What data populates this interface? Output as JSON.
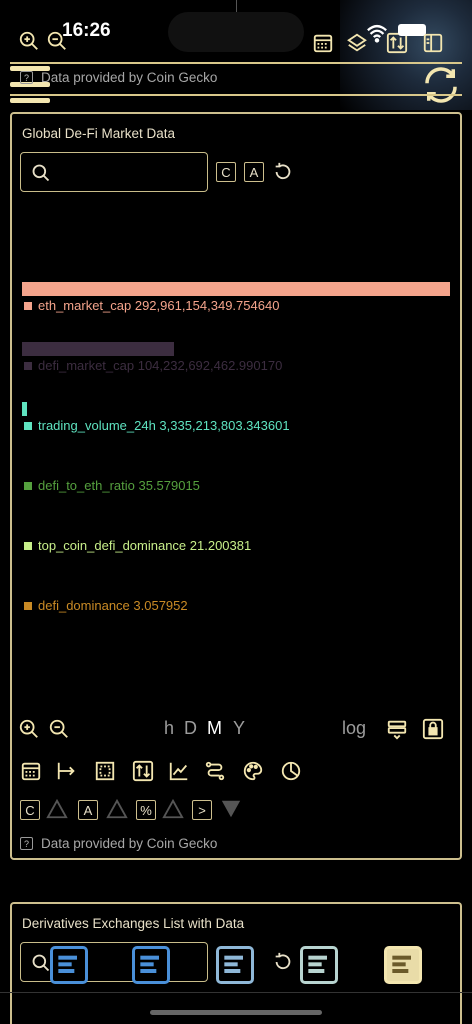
{
  "status_bar": {
    "time": "16:26"
  },
  "header": {
    "credit_text": "Data provided by Coin Gecko",
    "help_mark": "?"
  },
  "card1": {
    "title": "Global De-Fi Market Data",
    "search_placeholder": "",
    "tag_c": "C",
    "tag_a": "A",
    "bars": [
      {
        "label": "eth_market_cap",
        "value": "292,961,154,349.754640",
        "num": 292961154349.75464,
        "color": "#f4a48c"
      },
      {
        "label": "defi_market_cap",
        "value": "104,232,692,462.990170",
        "num": 104232692462.99017,
        "color": "#3c2d40"
      },
      {
        "label": "trading_volume_24h",
        "value": "3,335,213,803.343601",
        "num": 3335213803.343601,
        "color": "#5fe3c0"
      },
      {
        "label": "defi_to_eth_ratio",
        "value": "35.579015",
        "num": 35.579015,
        "color": "#55a03e"
      },
      {
        "label": "top_coin_defi_dominance",
        "value": "21.200381",
        "num": 21.200381,
        "color": "#c8ef8a"
      },
      {
        "label": "defi_dominance",
        "value": "3.057952",
        "num": 3.057952,
        "color": "#c98a25"
      }
    ],
    "timeframes": {
      "h": "h",
      "d": "D",
      "m": "M",
      "y": "Y",
      "selected": "M"
    },
    "log_label": "log",
    "toolbar2": {
      "c": "C",
      "a": "A",
      "pct": "%",
      "next": ">"
    },
    "credit_text": "Data provided by Coin Gecko",
    "help_mark": "?"
  },
  "card2": {
    "title": "Derivatives Exchanges List with Data",
    "dock_colors": [
      "#4a90d9",
      "#4a90d9",
      "#8fb8d8",
      "#b8d4d0",
      "#f3e6b0"
    ]
  }
}
